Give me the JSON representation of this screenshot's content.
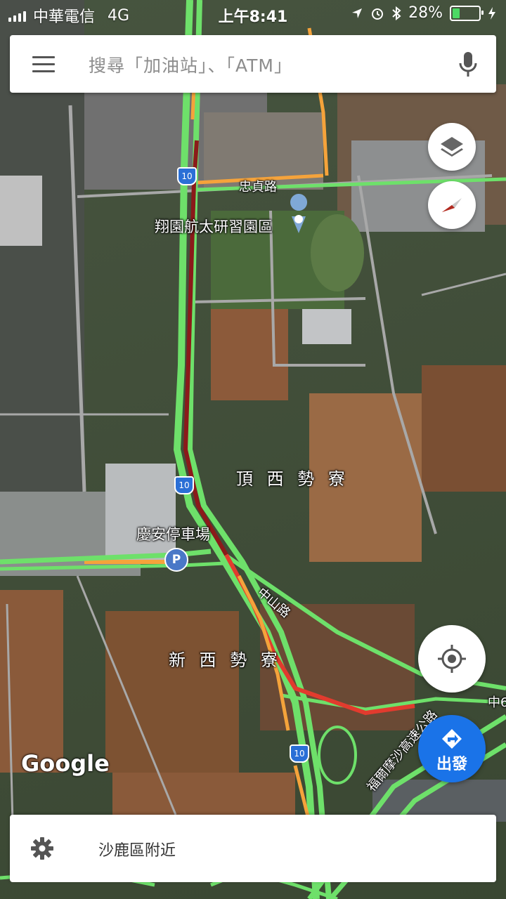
{
  "status_bar": {
    "carrier": "中華電信",
    "network": "4G",
    "time": "上午8:41",
    "battery": "28%",
    "battery_level": 0.28
  },
  "search": {
    "placeholder": "搜尋「加油站」、「ATM」"
  },
  "map": {
    "labels": {
      "road_zhongzhen": "忠貞路",
      "poi_aerospace": "翔園航太研習園區",
      "area_dingxishiliao": "頂 西 勢 寮",
      "poi_parking": "慶安停車場",
      "road_zhongshan": "中山路",
      "area_xinxishiliao": "新 西 勢 寮",
      "road_freeway": "福爾摩沙高速公路",
      "road_right_edge": "中6"
    },
    "shields": [
      "10",
      "10",
      "10"
    ],
    "google_logo": "Google"
  },
  "buttons": {
    "go_label": "出發"
  },
  "bottom_sheet": {
    "text": "沙鹿區附近"
  },
  "colors": {
    "traffic_green": "#6ee06a",
    "traffic_orange": "#f5a33b",
    "traffic_red": "#e23b2e",
    "traffic_darkred": "#8b1a1a",
    "accent_blue": "#1a73e8"
  }
}
